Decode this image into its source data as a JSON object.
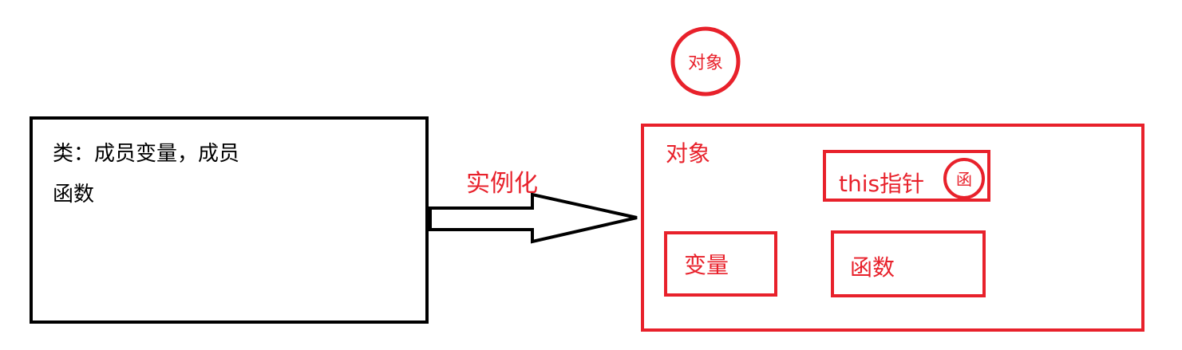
{
  "colors": {
    "black": "#000000",
    "red": "#e8212b",
    "background": "#ffffff"
  },
  "class_box": {
    "line1": "类：成员变量，成员",
    "line2": "函数"
  },
  "arrow": {
    "label": "实例化"
  },
  "object_circle": {
    "label": "对象"
  },
  "object_box": {
    "title": "对象",
    "this_pointer": "this指针",
    "this_function_circle": "函",
    "variable_box": "变量",
    "function_box": "函数"
  }
}
